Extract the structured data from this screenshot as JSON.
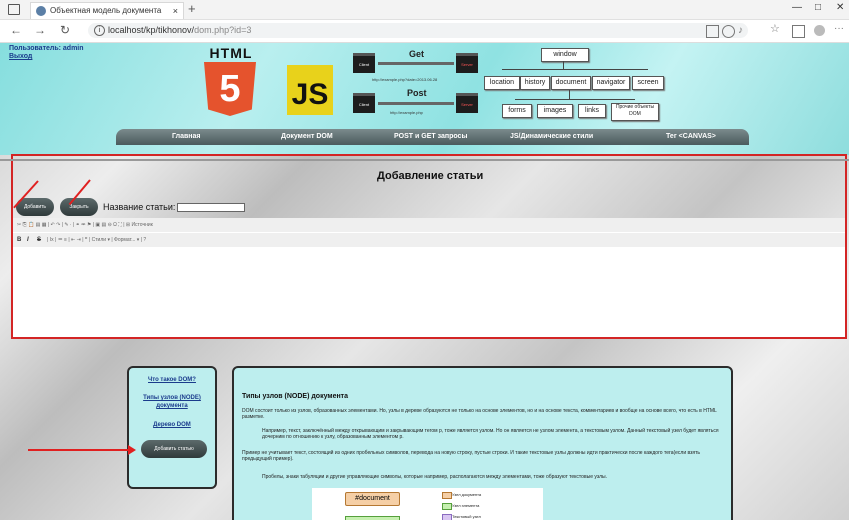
{
  "browser": {
    "tab_title": "Объектная модель документа",
    "tab_close": "×",
    "new_tab": "+",
    "url_main": "localhost/kp/tikhonov/",
    "url_path": "dom.php?id=3",
    "window_controls": [
      "—",
      "□",
      "✕"
    ]
  },
  "header": {
    "user_label": "Пользователь: admin",
    "logout_label": "Выход",
    "html_word": "HTML",
    "html_number": "5",
    "js_letters": "JS",
    "get_label": "Get",
    "post_label": "Post",
    "client_label": "Client",
    "server_label": "Server",
    "get_url": "http://example.php?date=2013.06.28",
    "post_url": "http://example.php",
    "dom_nodes": {
      "window": "window",
      "location": "location",
      "history": "history",
      "document": "document",
      "navigator": "navigator",
      "screen": "screen",
      "forms": "forms",
      "images": "images",
      "links": "links",
      "other": "Прочие объекты DOM"
    },
    "menu": [
      "Главная",
      "Документ DOM",
      "POST и GET запросы",
      "JS/Динамические стили",
      "Тег <CANVAS>"
    ]
  },
  "modal": {
    "title": "Добавление статьи",
    "add_button": "Добавить",
    "close_button": "Закрыть",
    "name_label": "Название статьи:",
    "name_value": "",
    "toolbar_row1": "✂ ⎘ 📋 ▤ ▦ | ↶ ↷ | ✎ · | ⚭ ⚮ ⚑ | ▣ ▤ ⊖ Ω ⛶ | ⊞ Источник",
    "toolbar_row2_b": "B",
    "toolbar_row2_i": "I",
    "toolbar_row2_s": "S",
    "toolbar_row2_rest": "| Ix | ≔ ≡ | ⇤ ⇥ | ❞ | Стили   ▾ | Формат...   ▾ | ?"
  },
  "sidebar": {
    "links": [
      "Что такое DOM?",
      "Типы узлов (NODE) документа",
      "Дерево DOM"
    ],
    "add_button": "Добавить статью"
  },
  "article": {
    "title": "Типы узлов (NODE) документа",
    "p1": "DOM состоит только из узлов, образованных элементами. Но, узлы в дереве образуются не только на основе элементов, но и на основе текста, комментариев и вообще на основе всего, что есть в HTML разметке.",
    "p2": "Например, текст, заключённый между открывающим и закрывающим тегом p, тоже является узлом. Но он является не узлом элемента, а текстовым узлом. Данный текстовый узел будет являться дочерним по отношению к узлу, образованным элементом p.",
    "p3": "Пример не учитывает текст, состоящий из одних пробельных символов, перевода на новую строку, пустые строки. И такие текстовые узлы должны идти практически после каждого тега(если взять предыдущий пример).",
    "p4": "Пробелы, знаки табуляции и другие управляющие символы, которые например, располагаются между элементами, тоже образуют текстовые узлы.",
    "diagram_root": "#document",
    "legend": [
      "Узел документа",
      "Узел элемента",
      "Текстовый узел"
    ]
  },
  "colors": {
    "highlight_border": "#d32525",
    "annotation_arrow": "#e02020",
    "header_bg": "#8fe2e2",
    "menu_bg": "#4a5a5d"
  }
}
